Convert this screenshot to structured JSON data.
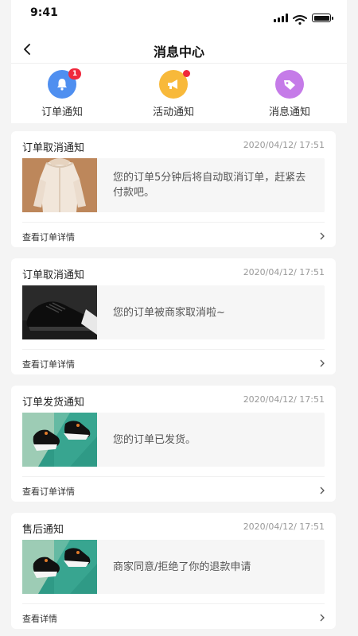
{
  "status": {
    "time": "9:41"
  },
  "navbar": {
    "title": "消息中心",
    "back_icon": "chevron-left-icon"
  },
  "categories": [
    {
      "label": "订单通知",
      "icon": "bell-icon",
      "color": "#4f8ff0",
      "badge": "1"
    },
    {
      "label": "活动通知",
      "icon": "megaphone-icon",
      "color": "#f8b93a",
      "badge_dot": true
    },
    {
      "label": "消息通知",
      "icon": "tag-icon",
      "color": "#c57be8"
    }
  ],
  "messages": [
    {
      "title": "订单取消通知",
      "time": "2020/04/12/ 17:51",
      "text": "您的订单5分钟后将自动取消订单，赶紧去付款吧。",
      "link": "查看订单详情",
      "thumb": "coat-image"
    },
    {
      "title": "订单取消通知",
      "time": "2020/04/12/ 17:51",
      "text": "您的订单被商家取消啦~",
      "link": "查看订单详情",
      "thumb": "sneaker-image"
    },
    {
      "title": "订单发货通知",
      "time": "2020/04/12/ 17:51",
      "text": "您的订单已发货。",
      "link": "查看订单详情",
      "thumb": "shoes-image"
    },
    {
      "title": "售后通知",
      "time": "2020/04/12/ 17:51",
      "text": "商家同意/拒绝了你的退款申请",
      "link": "查看详情",
      "thumb": "shoes-image"
    }
  ]
}
